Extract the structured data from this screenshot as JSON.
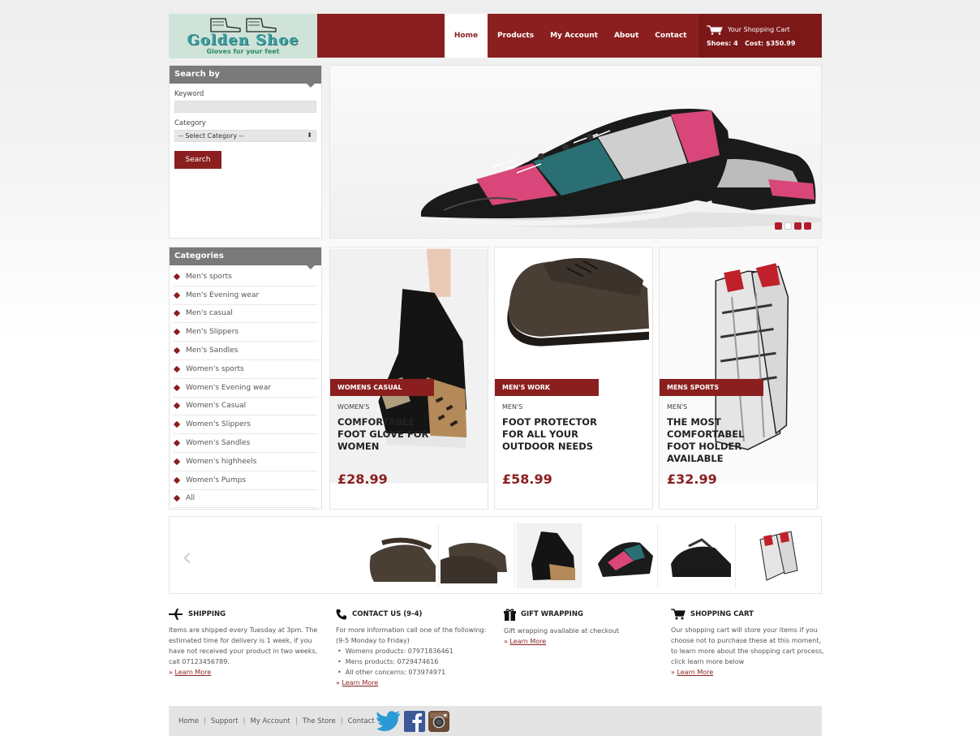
{
  "logo": {
    "title": "Golden Shoe",
    "tagline": "Gloves for your feet"
  },
  "nav": {
    "active": "Home",
    "items": [
      "Products",
      "My Account",
      "About",
      "Contact"
    ]
  },
  "cart": {
    "title": "Your Shopping Cart",
    "shoes_label": "Shoes: 4",
    "cost_label": "Cost: $350.99"
  },
  "search": {
    "heading": "Search by",
    "keyword_label": "Keyword",
    "keyword_value": "",
    "category_label": "Category",
    "category_selected": "-- Select Category --",
    "button_label": "Search"
  },
  "hero": {
    "active_slide": 2,
    "slide_count": 4
  },
  "categories": {
    "heading": "Categories",
    "items": [
      "Men's sports",
      "Men's Evening wear",
      "Men's casual",
      "Men's Slippers",
      "Men's Sandles",
      "Women's sports",
      "Women's Evening wear",
      "Women's Casual",
      "Women's Slippers",
      "Women's Sandles",
      "Women's highheels",
      "Women's Pumps",
      "All"
    ]
  },
  "products": [
    {
      "tag": "WOMENS CASUAL",
      "sub": "WOMEN'S",
      "title": "COMFORTABLE FOOT GLOVE FOR WOMEN",
      "price": "£28.99"
    },
    {
      "tag": "MEN'S WORK",
      "sub": "MEN'S",
      "title": "FOOT PROTECTOR FOR ALL YOUR OUTDOOR NEEDS",
      "price": "£58.99"
    },
    {
      "tag": "MENS SPORTS",
      "sub": "MEN'S",
      "title": "THE MOST COMFORTABEL FOOT HOLDER AVAILABLE",
      "price": "£32.99"
    }
  ],
  "carousel": {
    "prev_icon": "chevron-left-icon",
    "next_icon": "chevron-right-icon"
  },
  "info": {
    "shipping": {
      "heading": "SHIPPING",
      "text": "Items are shipped every Tuesday at 3pm. The estimated time for delivery is 1 week, if you have not received your product in two weeks, call 07123456789.",
      "link": "Learn More"
    },
    "contact": {
      "heading": "CONTACT US (9-4)",
      "text": "For more information call one of the following: (9-5 Monday to Friday)",
      "items": [
        "Womens products: 07971836461",
        "Mens products: 0729474616",
        "All other concerns: 073974971"
      ],
      "link": "Learn More"
    },
    "gift": {
      "heading": "GIFT WRAPPING",
      "text": "Gift wrapping available at checkout",
      "link": "Learn More"
    },
    "cart": {
      "heading": "SHOPPING CART",
      "text": "Our shopping cart will store your items if you choose not to purchase these at this moment, to learn more about the shopping cart process, click learn more below",
      "link": "Learn More"
    }
  },
  "footer": {
    "links": [
      "Home",
      "Support",
      "My Account",
      "The Store",
      "Contact"
    ],
    "separator": "|"
  },
  "colors": {
    "brand": "#8b1f1f",
    "panel_head": "#7a7a7a",
    "footer_bg": "#e4e4e4"
  }
}
